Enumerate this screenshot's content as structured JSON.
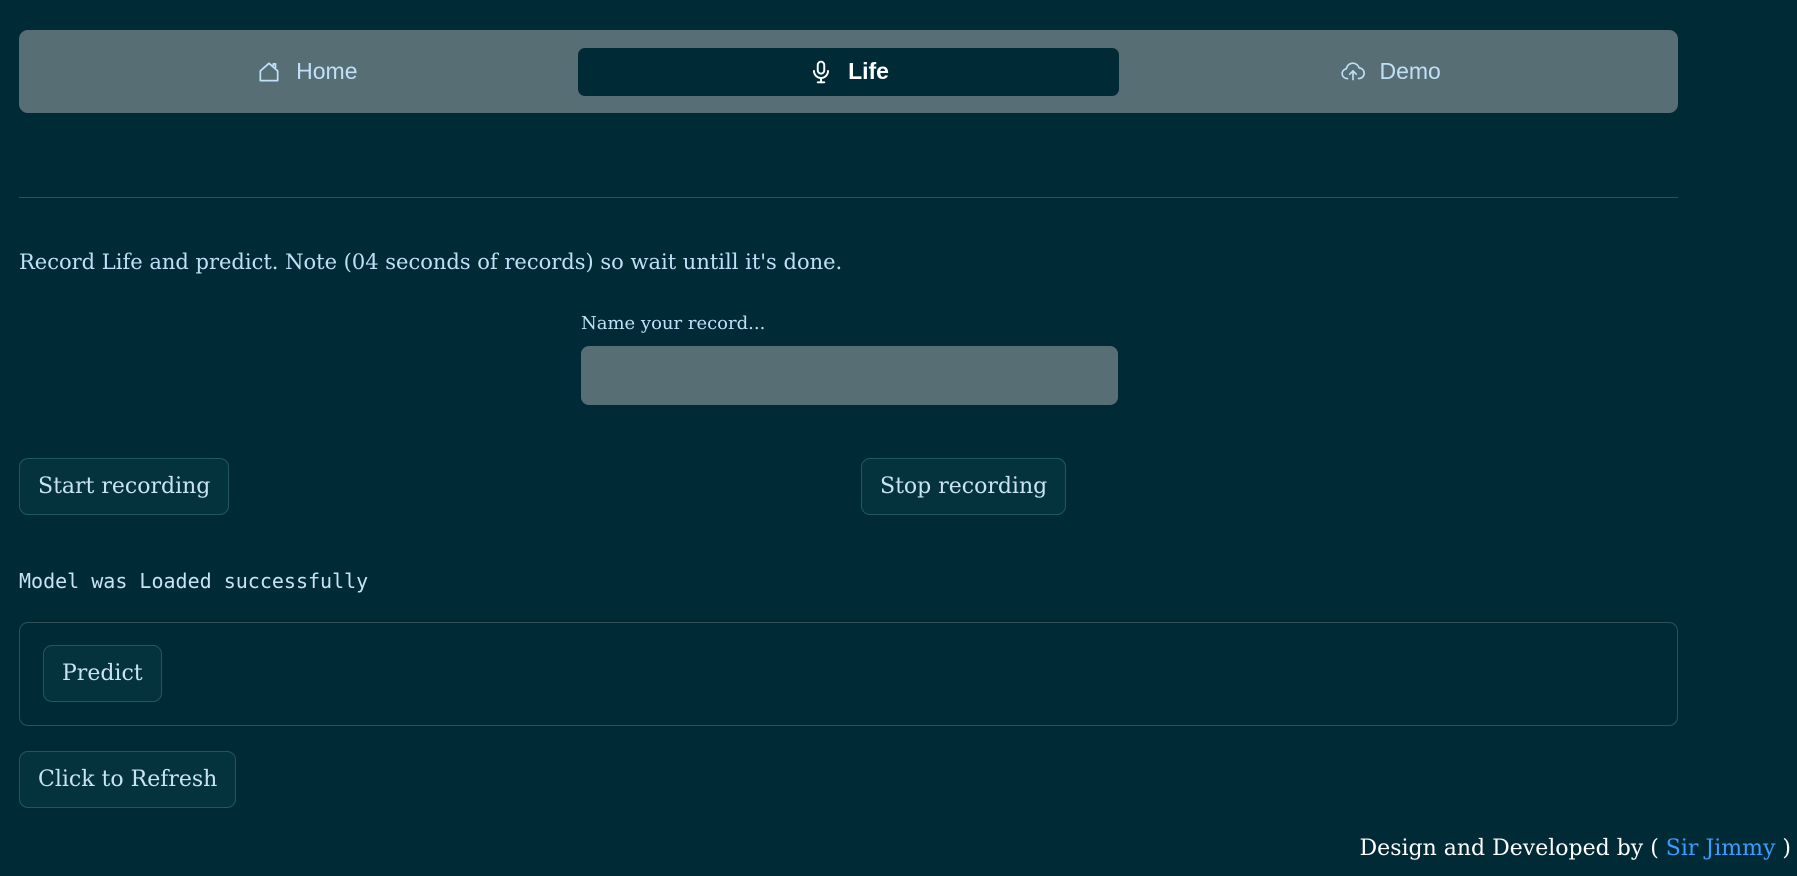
{
  "nav": {
    "items": [
      {
        "label": "Home",
        "icon": "home-icon",
        "active": false
      },
      {
        "label": "Life",
        "icon": "microphone-icon",
        "active": true
      },
      {
        "label": "Demo",
        "icon": "cloud-upload-icon",
        "active": false
      }
    ]
  },
  "intro_text": "Record Life and predict. Note (04 seconds of records) so wait untill it's done.",
  "record_name": {
    "label": "Name your record...",
    "value": "",
    "placeholder": ""
  },
  "buttons": {
    "start_recording": "Start recording",
    "stop_recording": "Stop recording",
    "predict": "Predict",
    "refresh": "Click to Refresh"
  },
  "status_text": "Model was Loaded successfully",
  "footer": {
    "prefix": "Design and Developed by (",
    "author": "Sir Jimmy",
    "suffix": ")"
  },
  "colors": {
    "background": "#002b36",
    "navbar": "#586e75",
    "link": "#3b9dff"
  }
}
